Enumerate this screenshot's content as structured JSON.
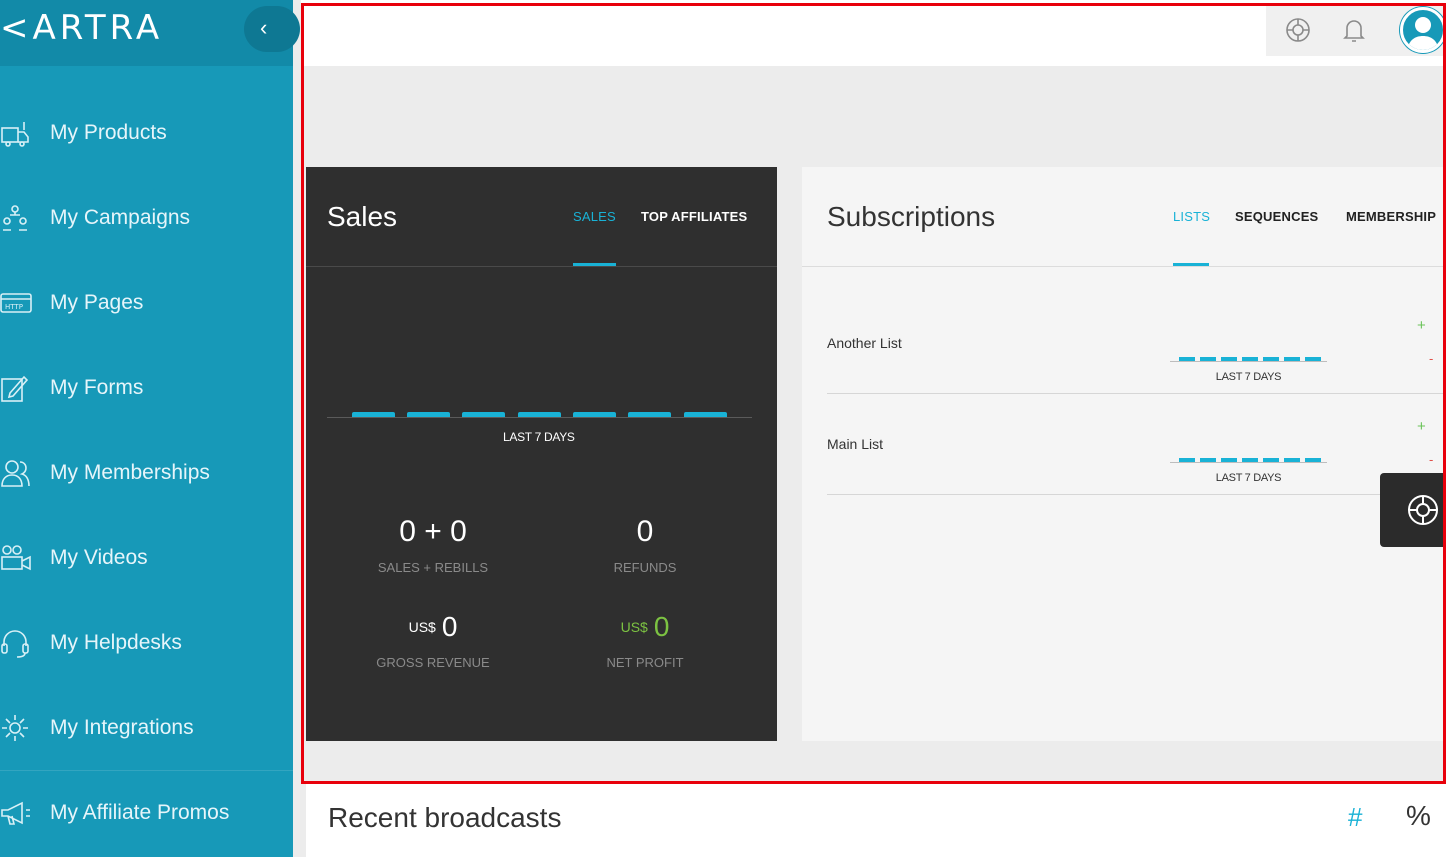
{
  "sidebar": {
    "logo": "<ARTRA",
    "collapse_icon": "chevron-left-icon",
    "items": [
      {
        "label": "My Products",
        "icon": "products-icon"
      },
      {
        "label": "My Campaigns",
        "icon": "campaigns-icon"
      },
      {
        "label": "My Pages",
        "icon": "pages-icon"
      },
      {
        "label": "My Forms",
        "icon": "forms-icon"
      },
      {
        "label": "My Memberships",
        "icon": "memberships-icon"
      },
      {
        "label": "My Videos",
        "icon": "videos-icon"
      },
      {
        "label": "My Helpdesks",
        "icon": "helpdesks-icon"
      },
      {
        "label": "My Integrations",
        "icon": "integrations-icon"
      },
      {
        "label": "My Affiliate Promos",
        "icon": "affiliate-promos-icon"
      }
    ]
  },
  "header": {
    "icons": [
      "support-icon",
      "bell-icon",
      "user-avatar-icon"
    ]
  },
  "sales": {
    "title": "Sales",
    "tabs": [
      {
        "label": "SALES",
        "active": true
      },
      {
        "label": "TOP AFFILIATES",
        "active": false
      }
    ],
    "chart_caption": "LAST 7 DAYS",
    "stats": {
      "sales_rebills_value": "0 + 0",
      "sales_rebills_label": "SALES + REBILLS",
      "refunds_value": "0",
      "refunds_label": "REFUNDS",
      "gross_currency": "US$",
      "gross_value": "0",
      "gross_label": "GROSS REVENUE",
      "net_currency": "US$",
      "net_value": "0",
      "net_label": "NET PROFIT"
    }
  },
  "subscriptions": {
    "title": "Subscriptions",
    "tabs": [
      {
        "label": "LISTS",
        "active": true
      },
      {
        "label": "SEQUENCES",
        "active": false
      },
      {
        "label": "MEMBERSHIP",
        "active": false
      }
    ],
    "lists": [
      {
        "name": "Another List",
        "caption": "LAST 7 DAYS",
        "plus": "+",
        "minus": "-"
      },
      {
        "name": "Main List",
        "caption": "LAST 7 DAYS",
        "plus": "+",
        "minus": "-"
      }
    ]
  },
  "recent_broadcasts": {
    "title": "Recent broadcasts",
    "col_hash": "#",
    "col_pct": "%"
  },
  "colors": {
    "sidebar": "#1799b8",
    "accent": "#19b2d6",
    "sales_panel": "#2f2f2f",
    "net_profit_green": "#7cc242",
    "highlight_frame": "#e8000b"
  }
}
